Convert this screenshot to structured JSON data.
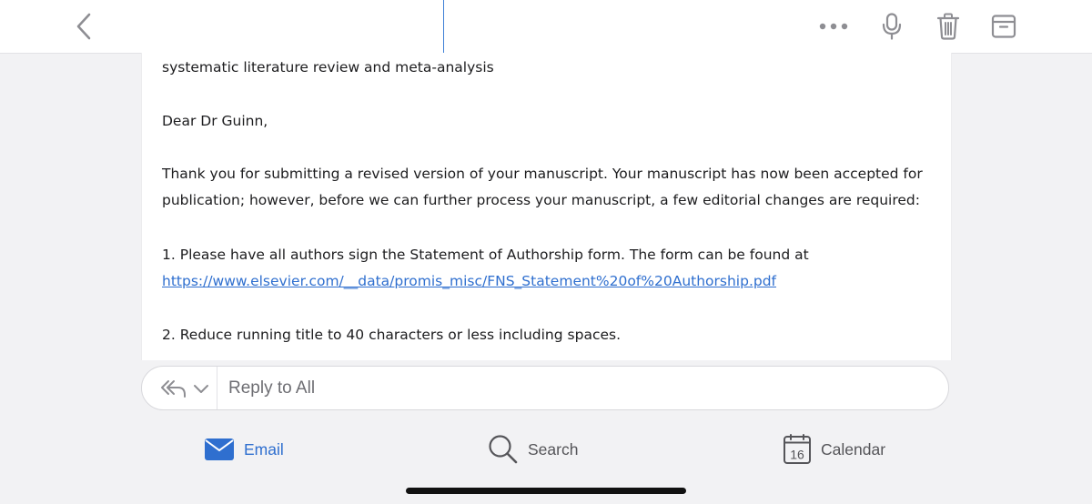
{
  "message": {
    "subject_tail": "systematic literature review and meta-analysis",
    "greeting": "Dear Dr Guinn,",
    "paragraph1_line1": "Thank you for submitting a revised version of your manuscript. Your manuscript has now been accepted for",
    "paragraph1_line2": "publication; however, before we can further process your manuscript, a few editorial changes are required:",
    "item1_text": "1. Please have all authors sign the Statement of Authorship form. The form can be found at",
    "item1_link": "https://www.elsevier.com/__data/promis_misc/FNS_Statement%20of%20Authorship.pdf",
    "item2_text": "2. Reduce running title to 40 characters or less including spaces."
  },
  "reply": {
    "placeholder": "Reply to All"
  },
  "tabs": [
    {
      "label": "Email",
      "icon": "envelope-icon",
      "active": true
    },
    {
      "label": "Search",
      "icon": "magnifier-icon",
      "active": false
    },
    {
      "label": "Calendar",
      "icon": "calendar-icon",
      "active": false,
      "badge": "16"
    }
  ],
  "toolbar": {
    "icons": [
      "back-chevron-icon",
      "more-icon",
      "microphone-icon",
      "trash-icon",
      "archive-icon"
    ]
  },
  "colors": {
    "accent": "#2f6fcf",
    "icon_gray": "#8e8e93",
    "background": "#f2f2f4"
  }
}
